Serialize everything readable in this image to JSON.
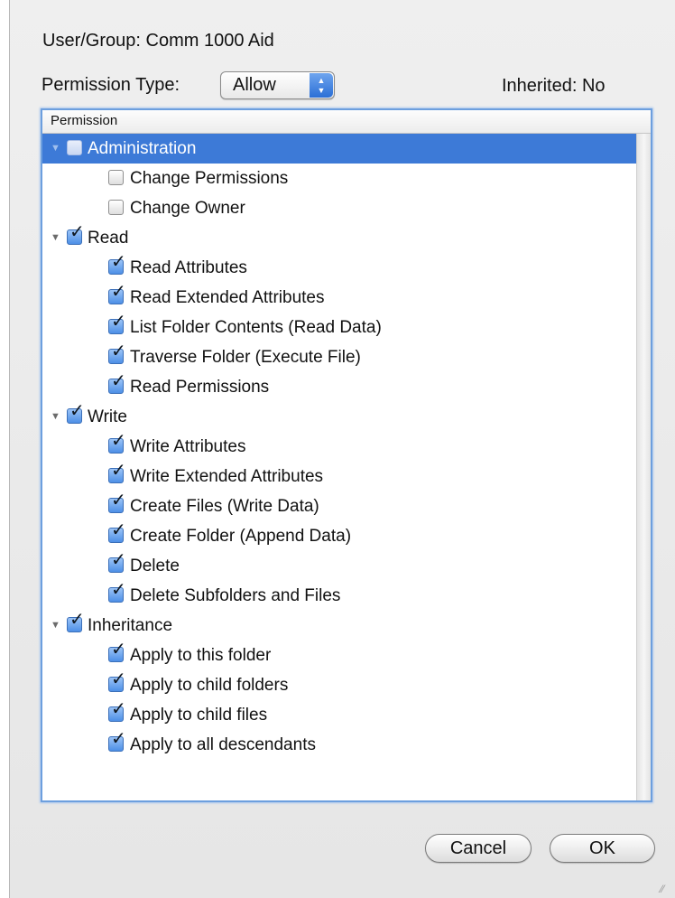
{
  "header": {
    "user_group_label": "User/Group:",
    "user_group_value": "Comm 1000 Aid",
    "permission_type_label": "Permission Type:",
    "permission_type_value": "Allow",
    "inherited_label": "Inherited:",
    "inherited_value": "No"
  },
  "outline": {
    "column_header": "Permission",
    "rows": [
      {
        "label": "Administration",
        "level": 0,
        "checked": false,
        "expanded": true,
        "selected": true
      },
      {
        "label": "Change Permissions",
        "level": 1,
        "checked": false
      },
      {
        "label": "Change Owner",
        "level": 1,
        "checked": false
      },
      {
        "label": "Read",
        "level": 0,
        "checked": true,
        "expanded": true
      },
      {
        "label": "Read Attributes",
        "level": 1,
        "checked": true
      },
      {
        "label": "Read Extended Attributes",
        "level": 1,
        "checked": true
      },
      {
        "label": "List Folder Contents (Read Data)",
        "level": 1,
        "checked": true
      },
      {
        "label": "Traverse Folder (Execute File)",
        "level": 1,
        "checked": true
      },
      {
        "label": "Read Permissions",
        "level": 1,
        "checked": true
      },
      {
        "label": "Write",
        "level": 0,
        "checked": true,
        "expanded": true
      },
      {
        "label": "Write Attributes",
        "level": 1,
        "checked": true
      },
      {
        "label": "Write Extended Attributes",
        "level": 1,
        "checked": true
      },
      {
        "label": "Create Files (Write Data)",
        "level": 1,
        "checked": true
      },
      {
        "label": "Create Folder (Append Data)",
        "level": 1,
        "checked": true
      },
      {
        "label": "Delete",
        "level": 1,
        "checked": true
      },
      {
        "label": "Delete Subfolders and Files",
        "level": 1,
        "checked": true
      },
      {
        "label": "Inheritance",
        "level": 0,
        "checked": true,
        "expanded": true
      },
      {
        "label": "Apply to this folder",
        "level": 1,
        "checked": true
      },
      {
        "label": "Apply to child folders",
        "level": 1,
        "checked": true
      },
      {
        "label": "Apply to child files",
        "level": 1,
        "checked": true
      },
      {
        "label": "Apply to all descendants",
        "level": 1,
        "checked": true
      }
    ]
  },
  "buttons": {
    "cancel_label": "Cancel",
    "ok_label": "OK"
  },
  "colors": {
    "selection": "#3d7ad7",
    "focus_ring": "#6d9fde",
    "checkbox_checked": "#4d8fe6"
  },
  "icons": {
    "disclosure": "disclosure-triangle-icon",
    "checkmark": "checkmark-icon",
    "popup": "up-down-arrows-icon",
    "grip": "resize-grip-icon"
  }
}
